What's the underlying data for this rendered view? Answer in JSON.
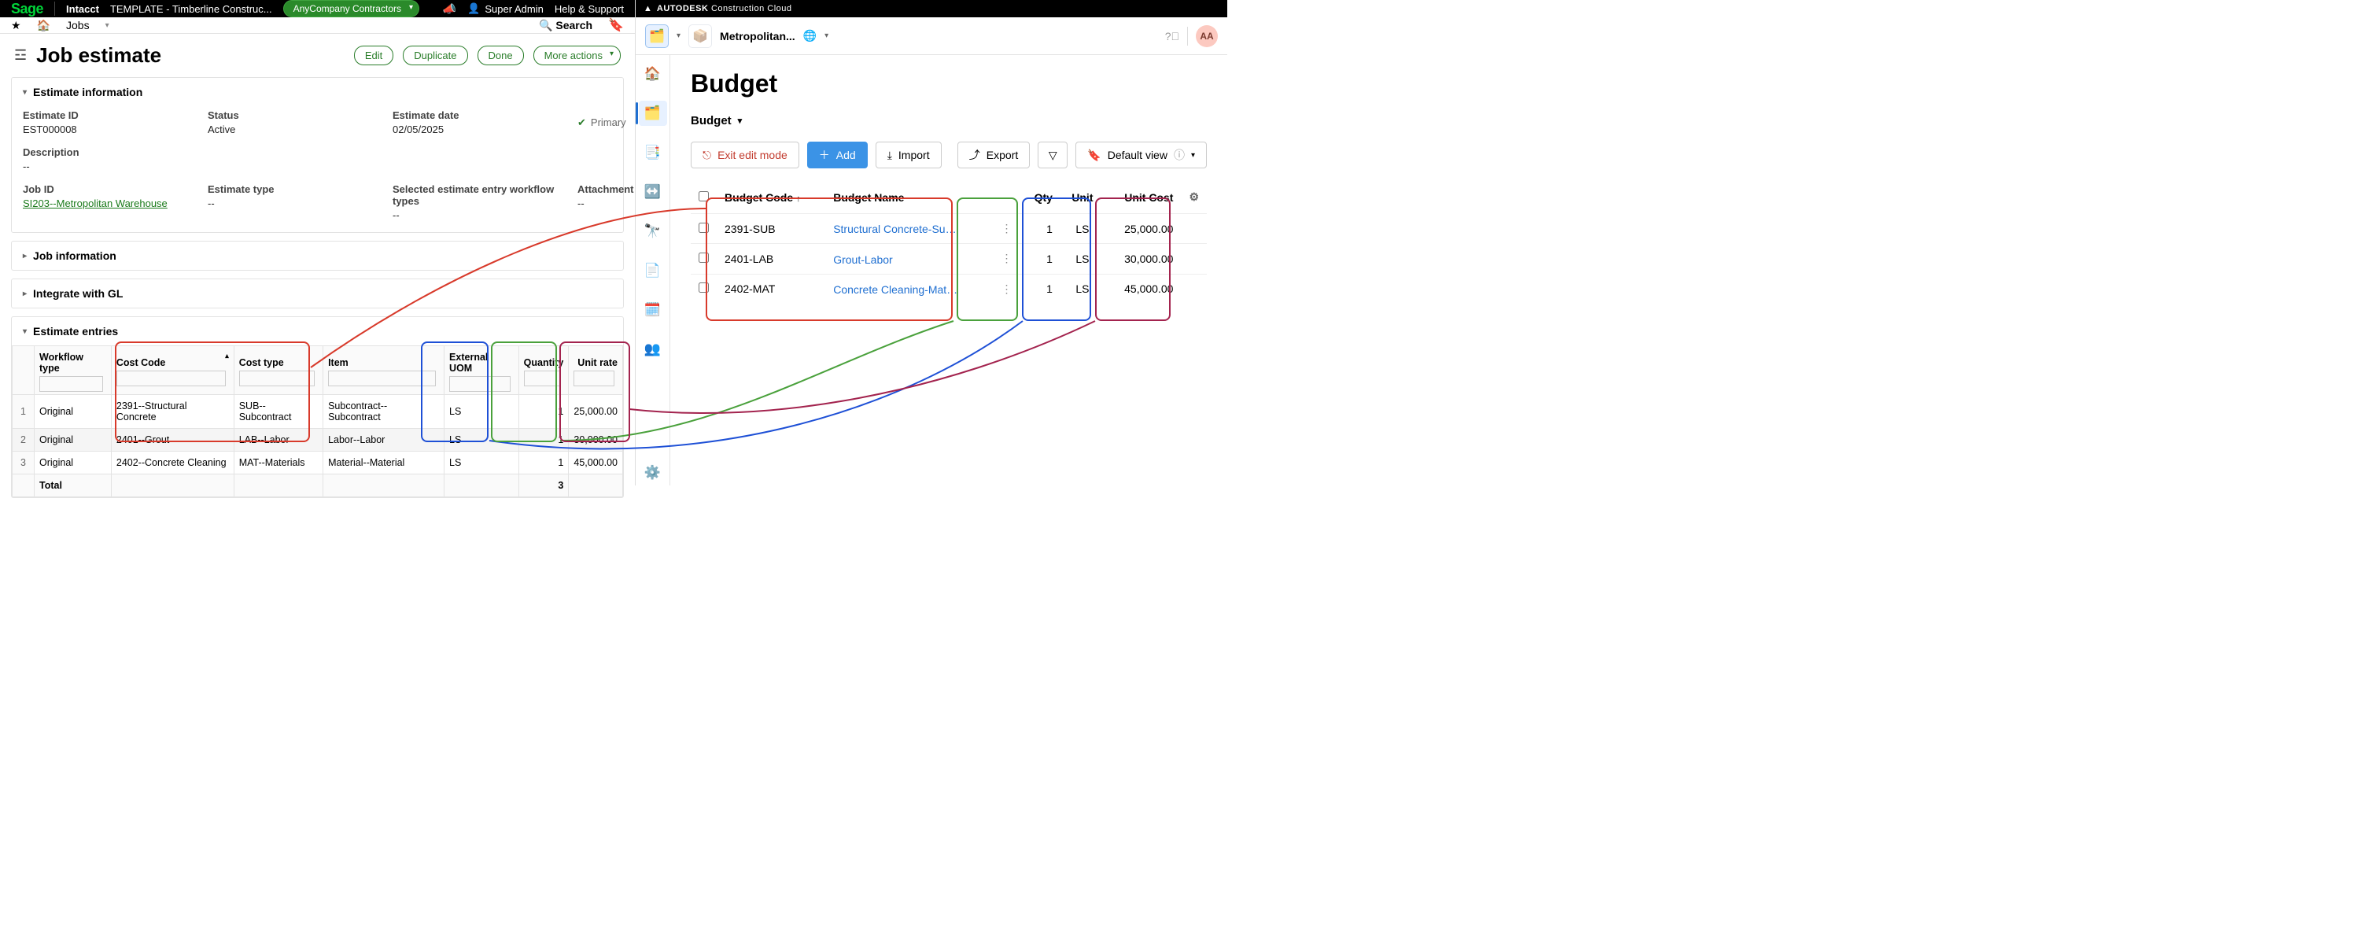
{
  "sage": {
    "brand": "Sage",
    "product": "Intacct",
    "context": "TEMPLATE - Timberline Construc...",
    "company_pill": "AnyCompany Contractors",
    "user_label": "Super Admin",
    "help_label": "Help & Support",
    "crumb": "Jobs",
    "search_label": "Search",
    "page_title": "Job estimate",
    "actions": {
      "edit": "Edit",
      "duplicate": "Duplicate",
      "done": "Done",
      "more": "More actions"
    },
    "sections": {
      "info_title": "Estimate information",
      "job_info": "Job information",
      "gl": "Integrate with GL",
      "entries_title": "Estimate entries"
    },
    "info": {
      "estimate_id_lbl": "Estimate ID",
      "estimate_id": "EST000008",
      "status_lbl": "Status",
      "status": "Active",
      "date_lbl": "Estimate date",
      "date": "02/05/2025",
      "primary_lbl": "Primary",
      "desc_lbl": "Description",
      "desc": "--",
      "job_lbl": "Job ID",
      "job": "SI203--Metropolitan Warehouse",
      "type_lbl": "Estimate type",
      "type": "--",
      "workflow_lbl": "Selected estimate entry workflow types",
      "workflow": "--",
      "attach_lbl": "Attachment",
      "attach": "--"
    },
    "entries": {
      "headers": {
        "idx": "",
        "wf": "Workflow type",
        "cost_code": "Cost Code",
        "cost_type": "Cost type",
        "item": "Item",
        "uom": "External UOM",
        "qty": "Quantity",
        "rate": "Unit rate"
      },
      "rows": [
        {
          "idx": "1",
          "wf": "Original",
          "cost_code": "2391--Structural Concrete",
          "cost_type": "SUB--Subcontract",
          "item": "Subcontract--Subcontract",
          "uom": "LS",
          "qty": "1",
          "rate": "25,000.00"
        },
        {
          "idx": "2",
          "wf": "Original",
          "cost_code": "2401--Grout",
          "cost_type": "LAB--Labor",
          "item": "Labor--Labor",
          "uom": "LS",
          "qty": "1",
          "rate": "30,000.00"
        },
        {
          "idx": "3",
          "wf": "Original",
          "cost_code": "2402--Concrete Cleaning",
          "cost_type": "MAT--Materials",
          "item": "Material--Material",
          "uom": "LS",
          "qty": "1",
          "rate": "45,000.00"
        }
      ],
      "total_lbl": "Total",
      "total_qty": "3"
    }
  },
  "adsk": {
    "brand_a": "AUTODESK",
    "brand_b": "Construction Cloud",
    "project": "Metropolitan...",
    "avatar": "AA",
    "page_title": "Budget",
    "view": "Budget",
    "buttons": {
      "exit": "Exit edit mode",
      "add": "Add",
      "import": "Import",
      "export": "Export",
      "default_view": "Default view"
    },
    "headers": {
      "code": "Budget Code",
      "name": "Budget Name",
      "qty": "Qty",
      "unit": "Unit",
      "cost": "Unit Cost"
    },
    "rows": [
      {
        "code": "2391-SUB",
        "name": "Structural Concrete-Subco...",
        "qty": "1",
        "unit": "LS",
        "cost": "25,000.00"
      },
      {
        "code": "2401-LAB",
        "name": "Grout-Labor",
        "qty": "1",
        "unit": "LS",
        "cost": "30,000.00"
      },
      {
        "code": "2402-MAT",
        "name": "Concrete Cleaning-Materia...",
        "qty": "1",
        "unit": "LS",
        "cost": "45,000.00"
      }
    ]
  }
}
